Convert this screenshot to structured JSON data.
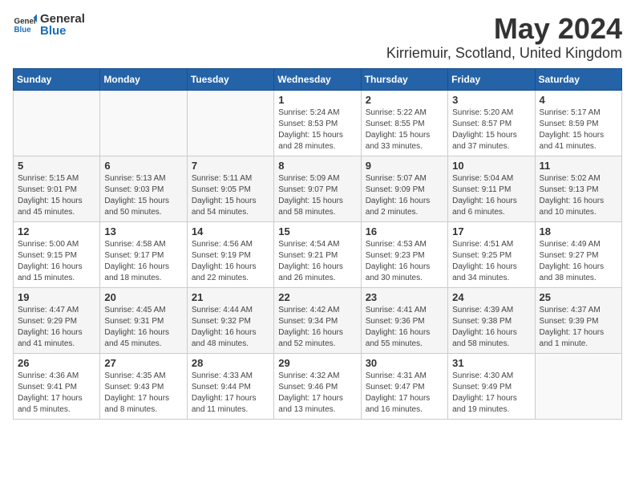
{
  "header": {
    "logo_general": "General",
    "logo_blue": "Blue",
    "month": "May 2024",
    "location": "Kirriemuir, Scotland, United Kingdom"
  },
  "weekdays": [
    "Sunday",
    "Monday",
    "Tuesday",
    "Wednesday",
    "Thursday",
    "Friday",
    "Saturday"
  ],
  "weeks": [
    [
      {
        "day": "",
        "info": ""
      },
      {
        "day": "",
        "info": ""
      },
      {
        "day": "",
        "info": ""
      },
      {
        "day": "1",
        "info": "Sunrise: 5:24 AM\nSunset: 8:53 PM\nDaylight: 15 hours\nand 28 minutes."
      },
      {
        "day": "2",
        "info": "Sunrise: 5:22 AM\nSunset: 8:55 PM\nDaylight: 15 hours\nand 33 minutes."
      },
      {
        "day": "3",
        "info": "Sunrise: 5:20 AM\nSunset: 8:57 PM\nDaylight: 15 hours\nand 37 minutes."
      },
      {
        "day": "4",
        "info": "Sunrise: 5:17 AM\nSunset: 8:59 PM\nDaylight: 15 hours\nand 41 minutes."
      }
    ],
    [
      {
        "day": "5",
        "info": "Sunrise: 5:15 AM\nSunset: 9:01 PM\nDaylight: 15 hours\nand 45 minutes."
      },
      {
        "day": "6",
        "info": "Sunrise: 5:13 AM\nSunset: 9:03 PM\nDaylight: 15 hours\nand 50 minutes."
      },
      {
        "day": "7",
        "info": "Sunrise: 5:11 AM\nSunset: 9:05 PM\nDaylight: 15 hours\nand 54 minutes."
      },
      {
        "day": "8",
        "info": "Sunrise: 5:09 AM\nSunset: 9:07 PM\nDaylight: 15 hours\nand 58 minutes."
      },
      {
        "day": "9",
        "info": "Sunrise: 5:07 AM\nSunset: 9:09 PM\nDaylight: 16 hours\nand 2 minutes."
      },
      {
        "day": "10",
        "info": "Sunrise: 5:04 AM\nSunset: 9:11 PM\nDaylight: 16 hours\nand 6 minutes."
      },
      {
        "day": "11",
        "info": "Sunrise: 5:02 AM\nSunset: 9:13 PM\nDaylight: 16 hours\nand 10 minutes."
      }
    ],
    [
      {
        "day": "12",
        "info": "Sunrise: 5:00 AM\nSunset: 9:15 PM\nDaylight: 16 hours\nand 15 minutes."
      },
      {
        "day": "13",
        "info": "Sunrise: 4:58 AM\nSunset: 9:17 PM\nDaylight: 16 hours\nand 18 minutes."
      },
      {
        "day": "14",
        "info": "Sunrise: 4:56 AM\nSunset: 9:19 PM\nDaylight: 16 hours\nand 22 minutes."
      },
      {
        "day": "15",
        "info": "Sunrise: 4:54 AM\nSunset: 9:21 PM\nDaylight: 16 hours\nand 26 minutes."
      },
      {
        "day": "16",
        "info": "Sunrise: 4:53 AM\nSunset: 9:23 PM\nDaylight: 16 hours\nand 30 minutes."
      },
      {
        "day": "17",
        "info": "Sunrise: 4:51 AM\nSunset: 9:25 PM\nDaylight: 16 hours\nand 34 minutes."
      },
      {
        "day": "18",
        "info": "Sunrise: 4:49 AM\nSunset: 9:27 PM\nDaylight: 16 hours\nand 38 minutes."
      }
    ],
    [
      {
        "day": "19",
        "info": "Sunrise: 4:47 AM\nSunset: 9:29 PM\nDaylight: 16 hours\nand 41 minutes."
      },
      {
        "day": "20",
        "info": "Sunrise: 4:45 AM\nSunset: 9:31 PM\nDaylight: 16 hours\nand 45 minutes."
      },
      {
        "day": "21",
        "info": "Sunrise: 4:44 AM\nSunset: 9:32 PM\nDaylight: 16 hours\nand 48 minutes."
      },
      {
        "day": "22",
        "info": "Sunrise: 4:42 AM\nSunset: 9:34 PM\nDaylight: 16 hours\nand 52 minutes."
      },
      {
        "day": "23",
        "info": "Sunrise: 4:41 AM\nSunset: 9:36 PM\nDaylight: 16 hours\nand 55 minutes."
      },
      {
        "day": "24",
        "info": "Sunrise: 4:39 AM\nSunset: 9:38 PM\nDaylight: 16 hours\nand 58 minutes."
      },
      {
        "day": "25",
        "info": "Sunrise: 4:37 AM\nSunset: 9:39 PM\nDaylight: 17 hours\nand 1 minute."
      }
    ],
    [
      {
        "day": "26",
        "info": "Sunrise: 4:36 AM\nSunset: 9:41 PM\nDaylight: 17 hours\nand 5 minutes."
      },
      {
        "day": "27",
        "info": "Sunrise: 4:35 AM\nSunset: 9:43 PM\nDaylight: 17 hours\nand 8 minutes."
      },
      {
        "day": "28",
        "info": "Sunrise: 4:33 AM\nSunset: 9:44 PM\nDaylight: 17 hours\nand 11 minutes."
      },
      {
        "day": "29",
        "info": "Sunrise: 4:32 AM\nSunset: 9:46 PM\nDaylight: 17 hours\nand 13 minutes."
      },
      {
        "day": "30",
        "info": "Sunrise: 4:31 AM\nSunset: 9:47 PM\nDaylight: 17 hours\nand 16 minutes."
      },
      {
        "day": "31",
        "info": "Sunrise: 4:30 AM\nSunset: 9:49 PM\nDaylight: 17 hours\nand 19 minutes."
      },
      {
        "day": "",
        "info": ""
      }
    ]
  ]
}
